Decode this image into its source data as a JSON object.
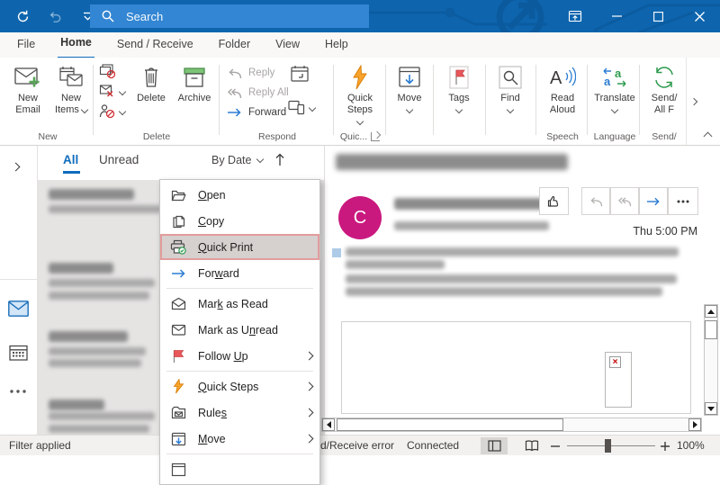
{
  "colors": {
    "titlebar_blue": "#0E65AE",
    "search_box_blue": "#3386D3",
    "accent_blue": "#0F6CBD",
    "avatar_pink": "#C9197F",
    "highlight_red_border": "#E29C9C",
    "flag_red": "#E8575A",
    "lightning_orange": "#F8A32B",
    "archive_green": "#7CC576"
  },
  "titlebar": {
    "search_placeholder": "Search"
  },
  "tabs": {
    "file": "File",
    "home": "Home",
    "send_receive": "Send / Receive",
    "folder": "Folder",
    "view": "View",
    "help": "Help"
  },
  "ribbon": {
    "new_email": "New Email",
    "new_items": "New Items",
    "delete": "Delete",
    "archive": "Archive",
    "reply": "Reply",
    "reply_all": "Reply All",
    "forward": "Forward",
    "quick_steps": "Quick Steps",
    "move": "Move",
    "tags": "Tags",
    "find": "Find",
    "read_aloud": "Read Aloud",
    "translate": "Translate",
    "send_receive_line1": "Send/",
    "send_receive_line2": "All F",
    "groups": {
      "new": "New",
      "delete": "Delete",
      "respond": "Respond",
      "quick_steps": "Quic...",
      "speech": "Speech",
      "language": "Language",
      "send": "Send/"
    }
  },
  "message_list": {
    "tab_all": "All",
    "tab_unread": "Unread",
    "sort_label": "By Date"
  },
  "reading_pane": {
    "avatar_initial": "C",
    "timestamp": "Thu 5:00 PM"
  },
  "context_menu": {
    "items": [
      {
        "label": "Open",
        "accel": 0
      },
      {
        "label": "Copy",
        "accel": 0
      },
      {
        "label": "Quick Print",
        "accel": 0
      },
      {
        "label": "Forward",
        "accel": 3
      },
      {
        "label": "Mark as Read",
        "accel": 3
      },
      {
        "label": "Mark as Unread",
        "accel": 9
      },
      {
        "label": "Follow Up",
        "accel": 7
      },
      {
        "label": "Quick Steps",
        "accel": 0
      },
      {
        "label": "Rules",
        "accel": 4
      },
      {
        "label": "Move",
        "accel": 0
      }
    ]
  },
  "status_bar": {
    "filter_status": "Filter applied",
    "send_receive_status": "d/Receive error",
    "connection_status": "Connected",
    "zoom_level": "100%"
  }
}
